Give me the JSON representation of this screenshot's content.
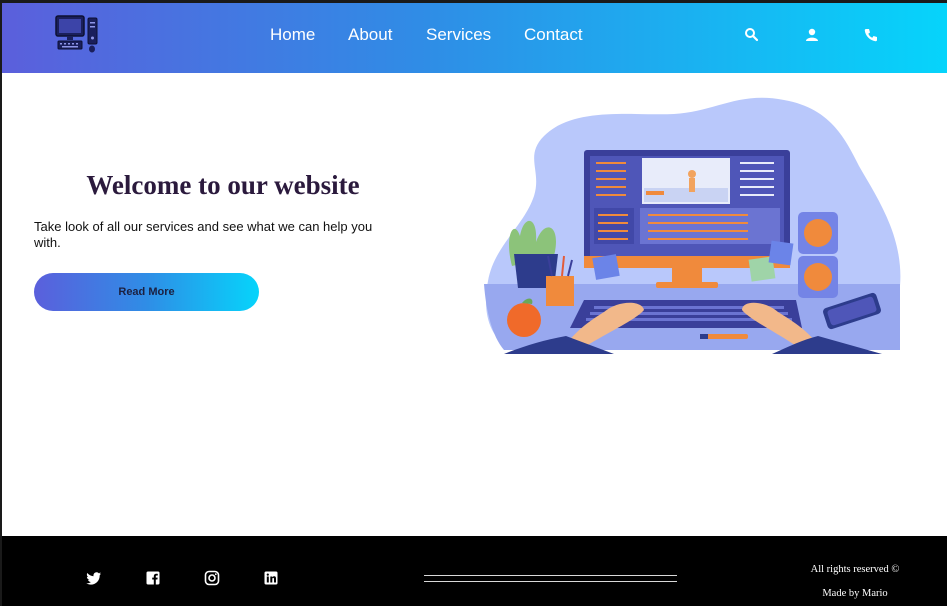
{
  "header": {
    "nav": [
      {
        "label": "Home"
      },
      {
        "label": "About"
      },
      {
        "label": "Services"
      },
      {
        "label": "Contact"
      }
    ],
    "icons": [
      "search-icon",
      "user-icon",
      "phone-icon"
    ],
    "logo_icon": "computer-icon"
  },
  "hero": {
    "title": "Welcome to our website",
    "text": "Take look of all our services and see what we can help you with.",
    "button_label": "Read More"
  },
  "footer": {
    "social_icons": [
      "twitter-icon",
      "facebook-icon",
      "instagram-icon",
      "linkedin-icon"
    ],
    "rights": "All rights reserved ©",
    "made_by": "Made by Mario"
  },
  "colors": {
    "gradient_start": "#5b5fdc",
    "gradient_mid": "#2f8de6",
    "gradient_end": "#06d4fb",
    "title_color": "#2b1a3d",
    "footer_bg": "#000000"
  }
}
